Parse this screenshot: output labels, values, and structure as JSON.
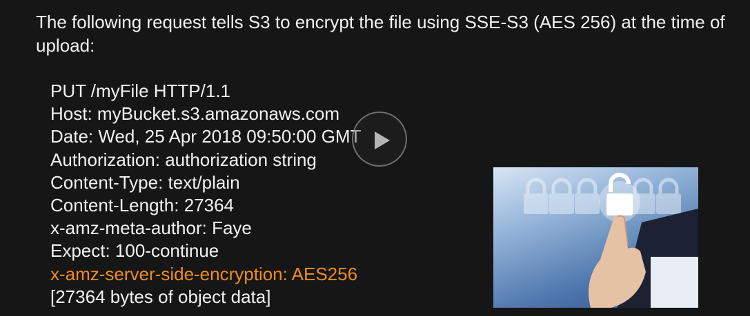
{
  "slide": {
    "intro_text": "The following request tells S3 to encrypt the file using SSE-S3 (AES 256) at the time of upload:",
    "request_lines": [
      "PUT /myFile HTTP/1.1",
      "Host: myBucket.s3.amazonaws.com",
      "Date: Wed, 25 Apr 2018 09:50:00 GMT",
      "Authorization: authorization string",
      "Content-Type: text/plain",
      "Content-Length: 27364",
      "x-amz-meta-author: Faye",
      "Expect: 100-continue",
      "x-amz-server-side-encryption: AES256",
      "[27364 bytes of object data]"
    ],
    "highlight_color": "#f08c1e"
  },
  "player": {
    "play_icon": "play-icon"
  },
  "image": {
    "subject": "hand-touching-unlocked-padlock-icon"
  }
}
